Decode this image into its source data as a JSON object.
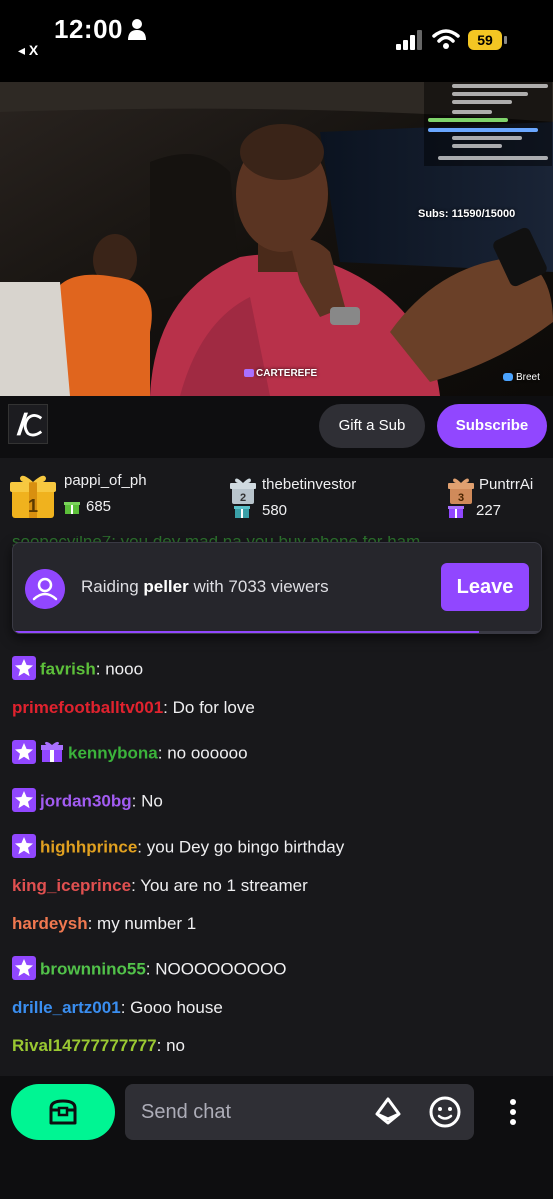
{
  "status_bar": {
    "time": "12:00",
    "back_app": "◂ X",
    "battery": "59"
  },
  "video": {
    "subs_label": "Subs: 11590/15000",
    "watermark": "CARTEREFE",
    "credit": "Breet"
  },
  "channel": {
    "gift_sub_label": "Gift a Sub",
    "subscribe_label": "Subscribe"
  },
  "leaderboard": [
    {
      "rank": "1",
      "name": "pappi_of_ph",
      "count": "685"
    },
    {
      "rank": "2",
      "name": "thebetinvestor",
      "count": "580"
    },
    {
      "rank": "3",
      "name": "PuntrrAi",
      "count": "227"
    }
  ],
  "raid": {
    "prefix": "Raiding ",
    "target": "peller",
    "suffix": " with 7033 viewers",
    "leave_label": "Leave",
    "progress": 0.88
  },
  "chat": {
    "partial_line": "soopocyilne7: you dey mad na you buy phone for ham",
    "messages": [
      {
        "user": "favrish",
        "text": "nooo",
        "color": "#5cbf3a",
        "badges": [
          "star"
        ]
      },
      {
        "user": "primefootballtv001",
        "text": "Do for love",
        "color": "#e0222e",
        "badges": []
      },
      {
        "user": "kennybona",
        "text": "no oooooo",
        "color": "#3bb33b",
        "badges": [
          "star",
          "gift"
        ]
      },
      {
        "user": "jordan30bg",
        "text": "No",
        "color": "#a25cf2",
        "badges": [
          "star"
        ]
      },
      {
        "user": "highhprince",
        "text": "you Dey go bingo birthday",
        "color": "#e0a020",
        "badges": [
          "star"
        ]
      },
      {
        "user": "king_iceprince",
        "text": "You are no 1 streamer",
        "color": "#e05050",
        "badges": []
      },
      {
        "user": "hardeysh",
        "text": "my number 1",
        "color": "#f07850",
        "badges": []
      },
      {
        "user": "brownnino55",
        "text": "NOOOOOOOOO",
        "color": "#52c24a",
        "badges": [
          "star"
        ]
      },
      {
        "user": "drille_artz001",
        "text": "Gooo house",
        "color": "#3a8ef0",
        "badges": []
      },
      {
        "user": "Rival14777777777",
        "text": "no",
        "color": "#9ac832",
        "badges": []
      }
    ]
  },
  "input": {
    "placeholder": "Send chat"
  },
  "colors": {
    "accent": "#9147ff",
    "points": "#00f593",
    "background": "#18181b"
  }
}
